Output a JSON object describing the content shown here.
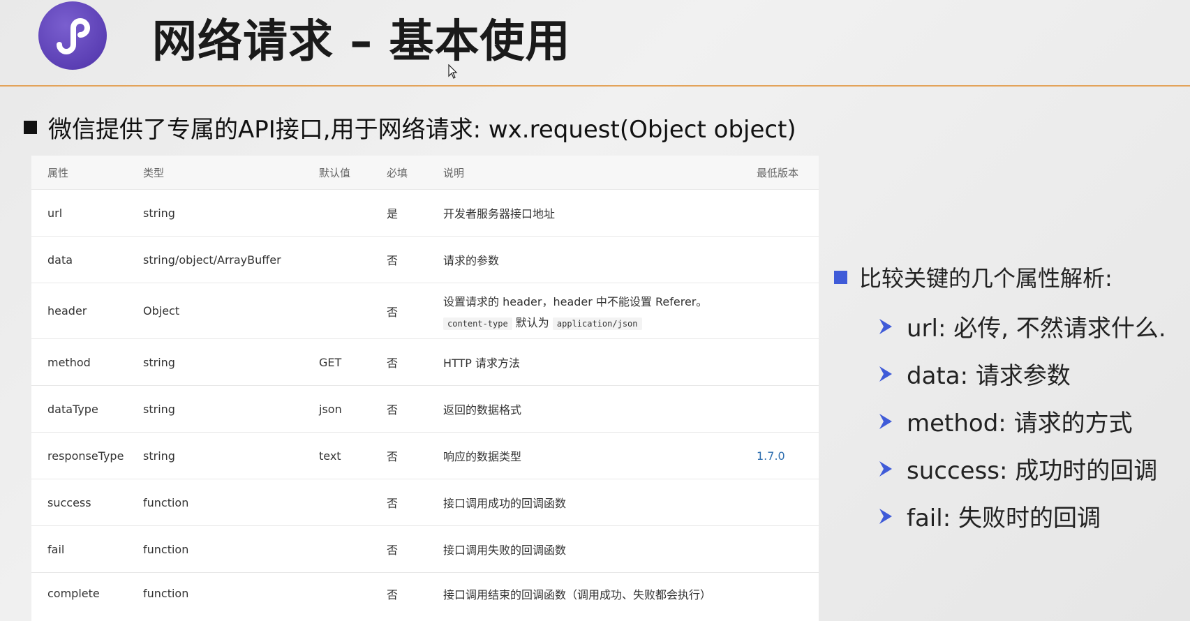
{
  "header": {
    "title": "网络请求 – 基本使用",
    "accent_color": "#e3a35a",
    "logo_icon": "mini-program-logo"
  },
  "main_bullet": "微信提供了专属的API接口,用于网络请求: wx.request(Object object)",
  "table": {
    "headers": [
      "属性",
      "类型",
      "默认值",
      "必填",
      "说明",
      "最低版本"
    ],
    "rows": [
      {
        "attr": "url",
        "type": "string",
        "default": "",
        "required": "是",
        "desc": "开发者服务器接口地址",
        "version": ""
      },
      {
        "attr": "data",
        "type": "string/object/ArrayBuffer",
        "default": "",
        "required": "否",
        "desc": "请求的参数",
        "version": ""
      },
      {
        "attr": "header",
        "type": "Object",
        "default": "",
        "required": "否",
        "desc": "设置请求的 header，header 中不能设置 Referer。",
        "desc_code1": "content-type",
        "desc_mid": "默认为",
        "desc_code2": "application/json",
        "version": ""
      },
      {
        "attr": "method",
        "type": "string",
        "default": "GET",
        "required": "否",
        "desc": "HTTP 请求方法",
        "version": ""
      },
      {
        "attr": "dataType",
        "type": "string",
        "default": "json",
        "required": "否",
        "desc": "返回的数据格式",
        "version": ""
      },
      {
        "attr": "responseType",
        "type": "string",
        "default": "text",
        "required": "否",
        "desc": "响应的数据类型",
        "version": "1.7.0"
      },
      {
        "attr": "success",
        "type": "function",
        "default": "",
        "required": "否",
        "desc": "接口调用成功的回调函数",
        "version": ""
      },
      {
        "attr": "fail",
        "type": "function",
        "default": "",
        "required": "否",
        "desc": "接口调用失败的回调函数",
        "version": ""
      },
      {
        "attr": "complete",
        "type": "function",
        "default": "",
        "required": "否",
        "desc": "接口调用结束的回调函数（调用成功、失败都会执行）",
        "version": ""
      }
    ]
  },
  "side": {
    "heading": "比较关键的几个属性解析:",
    "items": [
      "url: 必传, 不然请求什么.",
      "data: 请求参数",
      "method: 请求的方式",
      "success: 成功时的回调",
      "fail: 失败时的回调"
    ],
    "accent_color": "#3f5bd8"
  }
}
